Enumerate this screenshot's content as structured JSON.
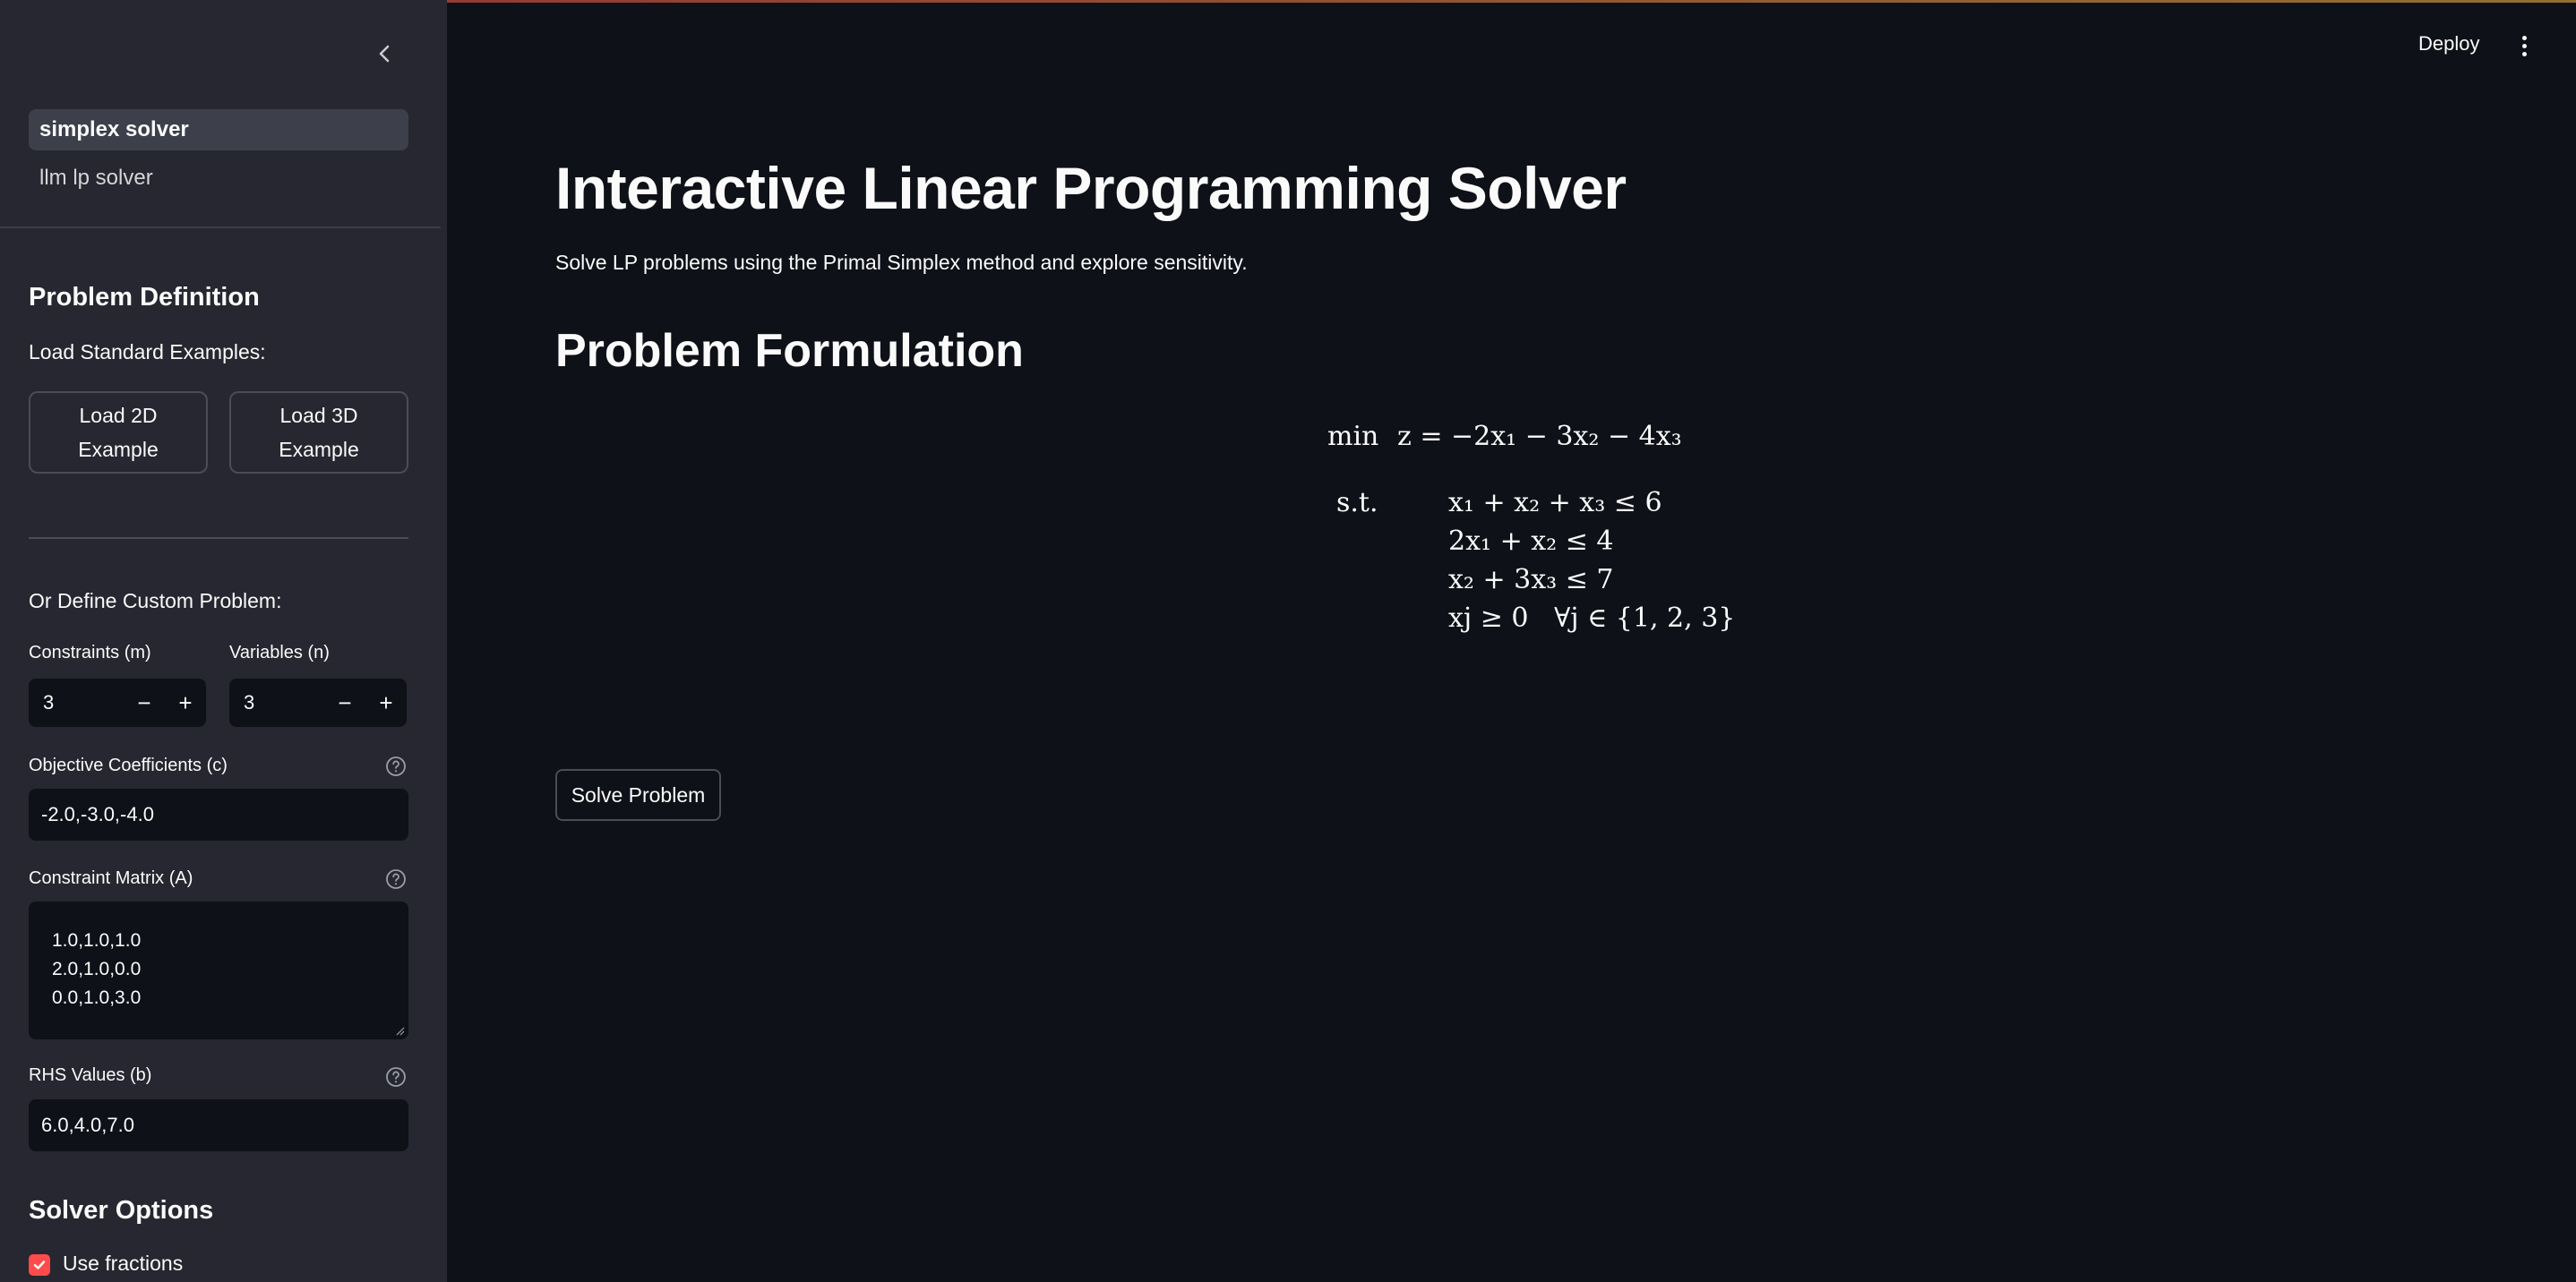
{
  "sidebar": {
    "nav": [
      {
        "label": "simplex solver",
        "active": true
      },
      {
        "label": "llm lp solver",
        "active": false
      }
    ],
    "problem_definition_heading": "Problem Definition",
    "load_examples_label": "Load Standard Examples:",
    "example_buttons": [
      {
        "label": "Load 2D Example"
      },
      {
        "label": "Load 3D Example"
      }
    ],
    "custom_problem_label": "Or Define Custom Problem:",
    "constraints": {
      "label": "Constraints (m)",
      "value": "3",
      "minus": "−",
      "plus": "+"
    },
    "variables": {
      "label": "Variables (n)",
      "value": "3",
      "minus": "−",
      "plus": "+"
    },
    "objective": {
      "label": "Objective Coefficients (c)",
      "value": "-2.0,-3.0,-4.0"
    },
    "matrix": {
      "label": "Constraint Matrix (A)",
      "lines": [
        "1.0,1.0,1.0",
        "2.0,1.0,0.0",
        "0.0,1.0,3.0"
      ]
    },
    "rhs": {
      "label": "RHS Values (b)",
      "value": "6.0,4.0,7.0"
    },
    "solver_options_heading": "Solver Options",
    "use_fractions": {
      "label": "Use fractions",
      "checked": true
    }
  },
  "header": {
    "deploy_label": "Deploy"
  },
  "main": {
    "title": "Interactive Linear Programming Solver",
    "subtitle": "Solve LP problems using the Primal Simplex method and explore sensitivity.",
    "formulation_heading": "Problem Formulation",
    "solve_button": "Solve Problem"
  },
  "formulation": {
    "sense": "min",
    "st": "s.t.",
    "objective": "z = −2x₁ − 3x₂ − 4x₃",
    "constraints": [
      "x₁ + x₂ + x₃ ≤ 6",
      "2x₁ + x₂ ≤ 4",
      "x₂ + 3x₃ ≤ 7",
      "xj ≥ 0   ∀j ∈ {1, 2, 3}"
    ]
  },
  "colors": {
    "sidebar_bg": "#262730",
    "main_bg": "#0e1117",
    "accent": "#ff4b4b"
  }
}
